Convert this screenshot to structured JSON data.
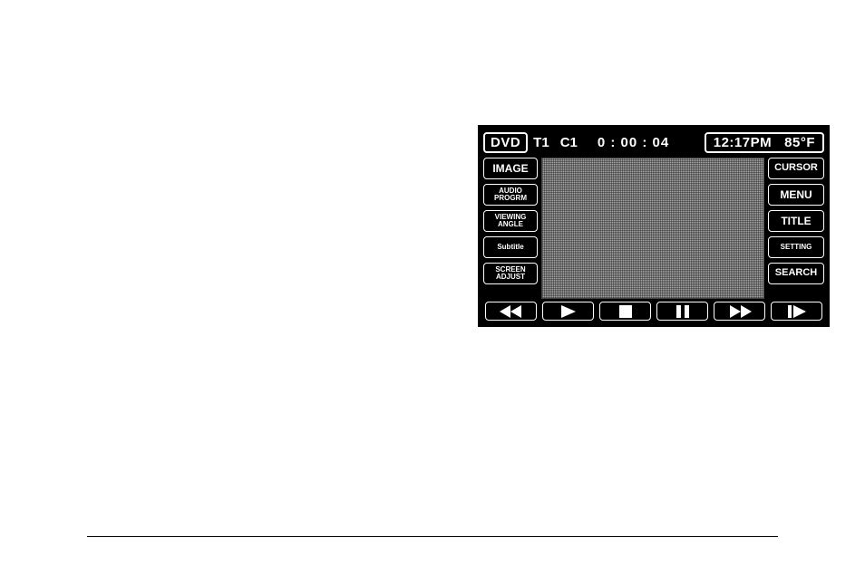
{
  "top": {
    "source_badge": "DVD",
    "title_num": "T1",
    "chapter_num": "C1",
    "elapsed": "0 : 00 : 04",
    "clock": "12:17PM",
    "temp": "85°F"
  },
  "left_buttons": {
    "image": "IMAGE",
    "audio_program_l1": "AUDIO",
    "audio_program_l2": "PROGRM",
    "viewing_angle_l1": "VIEWING",
    "viewing_angle_l2": "ANGLE",
    "subtitle": "Subtitle",
    "screen_adjust_l1": "SCREEN",
    "screen_adjust_l2": "ADJUST"
  },
  "right_buttons": {
    "cursor": "CURSOR",
    "menu": "MENU",
    "title": "TITLE",
    "setting": "SETTING",
    "search": "SEARCH"
  },
  "transport": {
    "rewind": "rewind",
    "play": "play",
    "stop": "stop",
    "pause": "pause",
    "ffwd": "fast-forward",
    "next": "next-chapter"
  }
}
